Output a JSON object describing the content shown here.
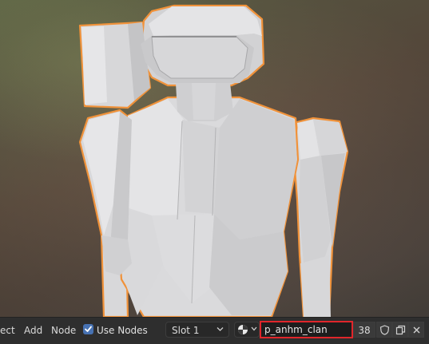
{
  "header": {
    "menu": [
      "ect",
      "Add",
      "Node"
    ],
    "use_nodes": {
      "label": "Use Nodes",
      "checked": true
    },
    "slot": {
      "label": "Slot 1"
    },
    "material": {
      "icon": "material-sphere-icon",
      "name": "p_anhm_clan",
      "users": "38"
    },
    "icons": {
      "fake_user": "shield-icon",
      "duplicate": "duplicate-icon",
      "unlink": "close-icon"
    }
  },
  "colors": {
    "selection_outline": "#f0923a",
    "highlight_box": "#e0262b",
    "checkbox": "#4772b3",
    "mesh": "#d8d8d8"
  }
}
